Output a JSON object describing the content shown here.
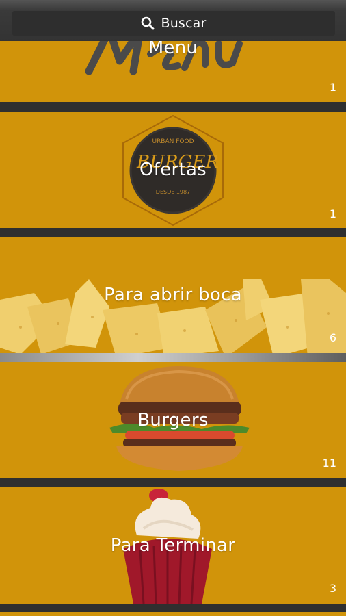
{
  "search": {
    "label": "Buscar",
    "icon": "search-icon"
  },
  "colors": {
    "card_bg": "#d1940a",
    "separator": "#2f2f2f",
    "text": "#ffffff"
  },
  "categories": [
    {
      "title": "Menu",
      "count": "1",
      "image": "menu-script-lettering"
    },
    {
      "title": "Ofertas",
      "count": "1",
      "image": "urban-food-burger-badge",
      "badge_text": [
        "URBAN FOOD",
        "BURGER",
        "DESDE 1987"
      ]
    },
    {
      "title": "Para abrir boca",
      "count": "6",
      "image": "nachos-chips"
    },
    {
      "title": "Burgers",
      "count": "11",
      "image": "burger-photo"
    },
    {
      "title": "Para Terminar",
      "count": "3",
      "image": "cupcake-photo"
    }
  ]
}
